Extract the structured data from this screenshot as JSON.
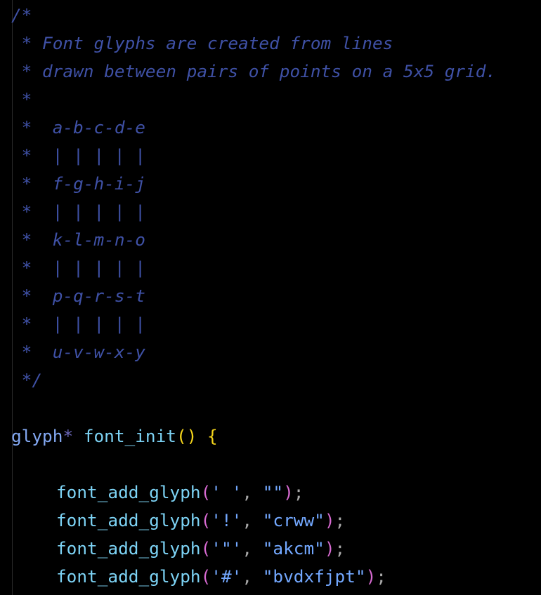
{
  "theme": {
    "background": "#000000",
    "comment": "#3f51a6",
    "type": "#83a8f2",
    "function": "#7dd3f5",
    "brace": "#f5d51b",
    "paren": "#d86ad2",
    "string": "#73a8ff",
    "punct": "#a9a9a9"
  },
  "comment_lines": [
    "/*",
    " * Font glyphs are created from lines",
    " * drawn between pairs of points on a 5x5 grid.",
    " *",
    " *  a-b-c-d-e",
    " *  | | | | |",
    " *  f-g-h-i-j",
    " *  | | | | |",
    " *  k-l-m-n-o",
    " *  | | | | |",
    " *  p-q-r-s-t",
    " *  | | | | |",
    " *  u-v-w-x-y",
    " */"
  ],
  "decl": {
    "type": "glyph",
    "pointer": "*",
    "name": "font_init",
    "parens": "()",
    "brace": "{"
  },
  "calls": [
    {
      "fn": "font_add_glyph",
      "open": "(",
      "char": "' '",
      "comma": ", ",
      "str": "\"\"",
      "close": ")",
      "semi": ";"
    },
    {
      "fn": "font_add_glyph",
      "open": "(",
      "char": "'!'",
      "comma": ", ",
      "str": "\"crww\"",
      "close": ")",
      "semi": ";"
    },
    {
      "fn": "font_add_glyph",
      "open": "(",
      "char": "'\"'",
      "comma": ", ",
      "str": "\"akcm\"",
      "close": ")",
      "semi": ";"
    },
    {
      "fn": "font_add_glyph",
      "open": "(",
      "char": "'#'",
      "comma": ", ",
      "str": "\"bvdxfjpt\"",
      "close": ")",
      "semi": ";"
    }
  ]
}
